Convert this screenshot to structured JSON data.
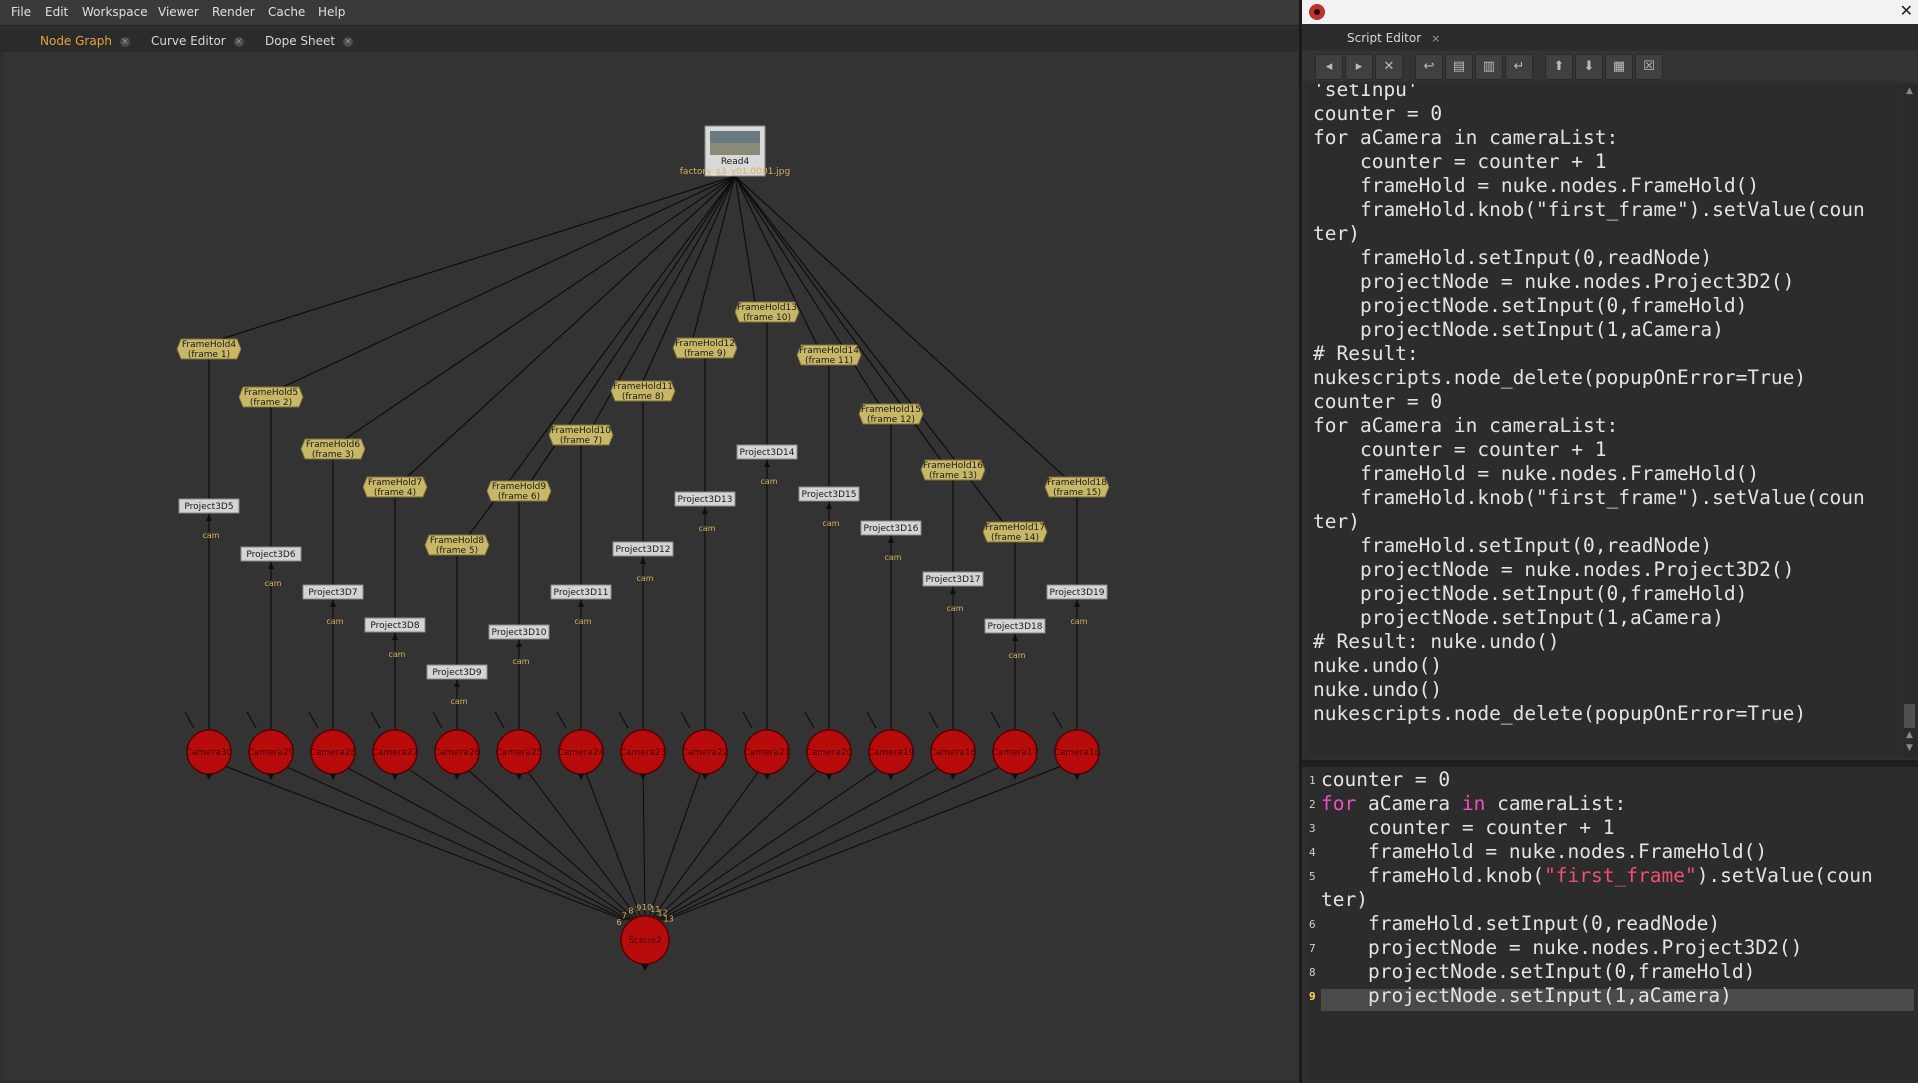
{
  "menu": [
    "File",
    "Edit",
    "Workspace",
    "Viewer",
    "Render",
    "Cache",
    "Help"
  ],
  "tabs": [
    {
      "label": "Node Graph",
      "active": true
    },
    {
      "label": "Curve Editor",
      "active": false
    },
    {
      "label": "Dope Sheet",
      "active": false
    }
  ],
  "graph": {
    "read_node": {
      "name": "Read4",
      "file": "factory_s3_v01.0001.jpg"
    },
    "frameholds": [
      {
        "name": "FrameHold4",
        "frame": "(frame 1)"
      },
      {
        "name": "FrameHold5",
        "frame": "(frame 2)"
      },
      {
        "name": "FrameHold6",
        "frame": "(frame 3)"
      },
      {
        "name": "FrameHold7",
        "frame": "(frame 4)"
      },
      {
        "name": "FrameHold8",
        "frame": "(frame 5)"
      },
      {
        "name": "FrameHold9",
        "frame": "(frame 6)"
      },
      {
        "name": "FrameHold10",
        "frame": "(frame 7)"
      },
      {
        "name": "FrameHold11",
        "frame": "(frame 8)"
      },
      {
        "name": "FrameHold12",
        "frame": "(frame 9)"
      },
      {
        "name": "FrameHold13",
        "frame": "(frame 10)"
      },
      {
        "name": "FrameHold14",
        "frame": "(frame 11)"
      },
      {
        "name": "FrameHold15",
        "frame": "(frame 12)"
      },
      {
        "name": "FrameHold16",
        "frame": "(frame 13)"
      },
      {
        "name": "FrameHold17",
        "frame": "(frame 14)"
      },
      {
        "name": "FrameHold18",
        "frame": "(frame 15)"
      }
    ],
    "projects": [
      "Project3D5",
      "Project3D6",
      "Project3D7",
      "Project3D8",
      "Project3D9",
      "Project3D10",
      "Project3D11",
      "Project3D12",
      "Project3D13",
      "Project3D14",
      "Project3D15",
      "Project3D16",
      "Project3D17",
      "Project3D18",
      "Project3D19"
    ],
    "cam_label": "cam",
    "cameras": [
      "Camera30",
      "Camera29",
      "Camera28",
      "Camera27",
      "Camera26",
      "Camera25",
      "Camera24",
      "Camera23",
      "Camera22",
      "Camera21",
      "Camera20",
      "Camera19",
      "Camera18",
      "Camera17",
      "Camera16"
    ],
    "scene_node": "Scene2",
    "scene_inputs": [
      "6",
      "7",
      "8",
      "9",
      "10",
      "11",
      "12",
      "13"
    ]
  },
  "script_editor": {
    "tab_label": "Script Editor",
    "output_lines": [
      "'setInpu'",
      "counter = 0",
      "for aCamera in cameraList:",
      "    counter = counter + 1",
      "    frameHold = nuke.nodes.FrameHold()",
      "    frameHold.knob(\"first_frame\").setValue(coun",
      "ter)",
      "    frameHold.setInput(0,readNode)",
      "    projectNode = nuke.nodes.Project3D2()",
      "    projectNode.setInput(0,frameHold)",
      "    projectNode.setInput(1,aCamera)",
      "# Result:",
      "nukescripts.node_delete(popupOnError=True)",
      "counter = 0",
      "for aCamera in cameraList:",
      "    counter = counter + 1",
      "    frameHold = nuke.nodes.FrameHold()",
      "    frameHold.knob(\"first_frame\").setValue(coun",
      "ter)",
      "    frameHold.setInput(0,readNode)",
      "    projectNode = nuke.nodes.Project3D2()",
      "    projectNode.setInput(0,frameHold)",
      "    projectNode.setInput(1,aCamera)",
      "# Result: nuke.undo()",
      "nuke.undo()",
      "nuke.undo()",
      "nukescripts.node_delete(popupOnError=True)"
    ],
    "input_line_numbers": [
      "1",
      "2",
      "3",
      "4",
      "5",
      "6",
      "7",
      "8",
      "9"
    ],
    "input_lines": [
      {
        "text": "counter = 0"
      },
      {
        "kw1": "for",
        "mid": " aCamera ",
        "kw2": "in",
        "rest": " cameraList:"
      },
      {
        "text": "    counter = counter + 1"
      },
      {
        "text": "    frameHold = nuke.nodes.FrameHold()"
      },
      {
        "pre": "    frameHold.knob(",
        "str": "\"first_frame\"",
        "post": ").setValue(coun"
      },
      {
        "text": "ter)"
      },
      {
        "text": "    frameHold.setInput(0,readNode)"
      },
      {
        "text": "    projectNode = nuke.nodes.Project3D2()"
      },
      {
        "text": "    projectNode.setInput(0,frameHold)"
      },
      {
        "text": "    projectNode.setInput(1,aCamera)"
      }
    ],
    "current_line": "9"
  },
  "colors": {
    "accent": "#e9a03c",
    "framehold": "#c9b768",
    "camera": "#b80c0c",
    "project": "#d4d4d4"
  }
}
